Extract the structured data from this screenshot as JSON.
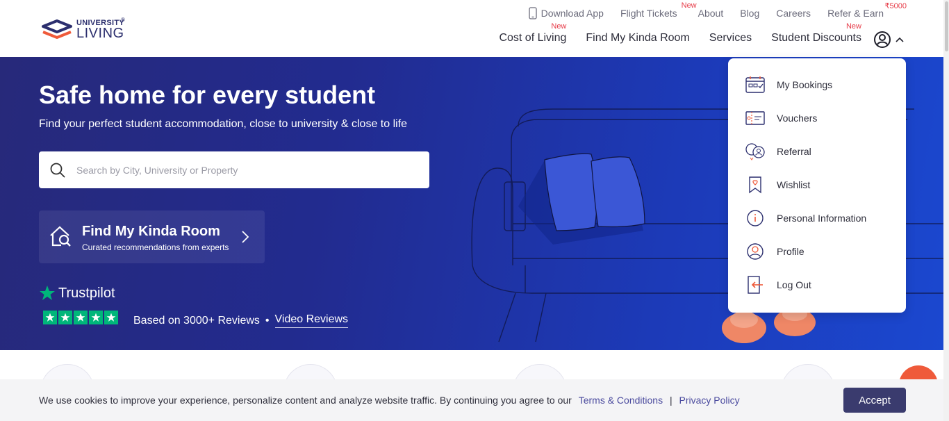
{
  "brand": {
    "line1": "UNIVERSITY",
    "line2": "LIVING",
    "reg": "®"
  },
  "topnav": {
    "download_app": "Download App",
    "flight_tickets": "Flight Tickets",
    "flight_tag": "New",
    "about": "About",
    "blog": "Blog",
    "careers": "Careers",
    "refer_earn": "Refer & Earn",
    "refer_tag": "₹5000"
  },
  "mainnav": {
    "cost_of_living": "Cost of Living",
    "cost_tag": "New",
    "find_room": "Find My Kinda Room",
    "services": "Services",
    "student_discounts": "Student Discounts",
    "discounts_tag": "New"
  },
  "hero": {
    "title": "Safe home for every student",
    "subtitle": "Find your perfect student accommodation, close to university & close to life",
    "search_placeholder": "Search by City, University or Property",
    "fmkr_title": "Find My Kinda Room",
    "fmkr_sub": "Curated recommendations from experts",
    "trustpilot": "Trustpilot",
    "reviews_text": "Based on 3000+ Reviews",
    "bullet": "•",
    "video_reviews": "Video Reviews"
  },
  "user_menu": {
    "items": [
      {
        "label": "My Bookings",
        "icon": "calendar-icon"
      },
      {
        "label": "Vouchers",
        "icon": "voucher-icon"
      },
      {
        "label": "Referral",
        "icon": "referral-icon"
      },
      {
        "label": "Wishlist",
        "icon": "bookmark-heart-icon"
      },
      {
        "label": "Personal Information",
        "icon": "info-icon"
      },
      {
        "label": "Profile",
        "icon": "profile-icon"
      },
      {
        "label": "Log Out",
        "icon": "logout-icon"
      }
    ]
  },
  "cookie": {
    "text": "We use cookies to improve your experience, personalize content and analyze website traffic. By continuing you agree to our",
    "terms": "Terms & Conditions",
    "sep": "|",
    "privacy": "Privacy Policy",
    "accept": "Accept"
  },
  "colors": {
    "hero_start": "#27297a",
    "hero_end": "#1b48d0",
    "accent_red": "#e63946",
    "trustpilot_green": "#00b67a",
    "accept_button": "#3a3b6e",
    "chat_button": "#ef5a3a"
  }
}
